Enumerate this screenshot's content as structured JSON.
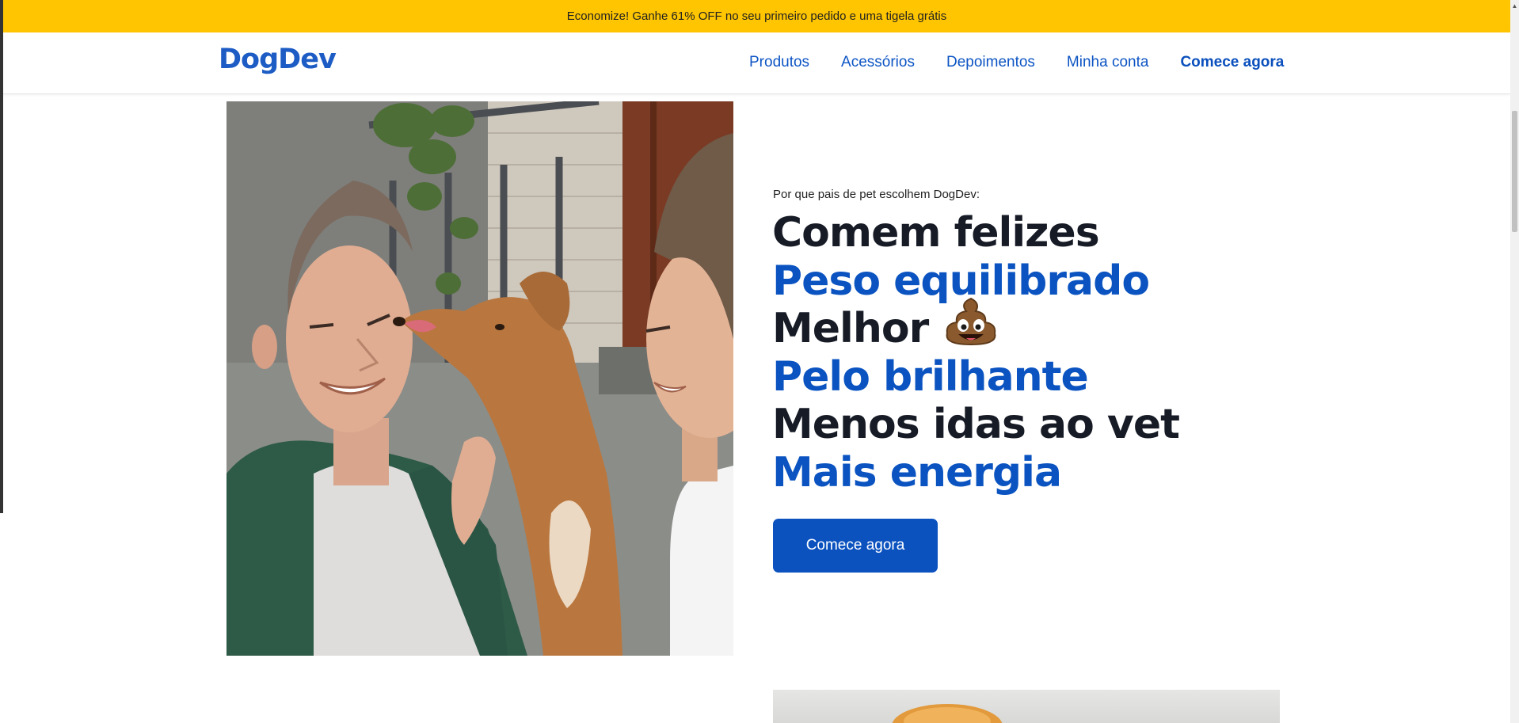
{
  "promo": {
    "text": "Economize! Ganhe 61% OFF no seu primeiro pedido e uma tigela grátis"
  },
  "header": {
    "logo": "DogDev",
    "nav": [
      {
        "label": "Produtos"
      },
      {
        "label": "Acessórios"
      },
      {
        "label": "Depoimentos"
      },
      {
        "label": "Minha conta"
      },
      {
        "label": "Comece agora",
        "emphasized": true
      }
    ]
  },
  "hero": {
    "eyebrow": "Por que pais de pet escolhem DogDev:",
    "benefits": [
      {
        "text": "Comem felizes",
        "color": "#161b26"
      },
      {
        "text": "Peso equilibrado",
        "color": "#0a53c0"
      },
      {
        "text": "Melhor",
        "color": "#161b26",
        "icon": "poop-emoji-icon"
      },
      {
        "text": "Pelo brilhante",
        "color": "#0a53c0"
      },
      {
        "text": "Menos idas ao vet",
        "color": "#161b26"
      },
      {
        "text": "Mais energia",
        "color": "#0a53c0"
      }
    ],
    "cta": "Comece agora",
    "photo": "couple-with-dog-photo"
  },
  "colors": {
    "promo_bg": "#ffc500",
    "brand_blue": "#0b52bf",
    "text_dark": "#161b26"
  }
}
